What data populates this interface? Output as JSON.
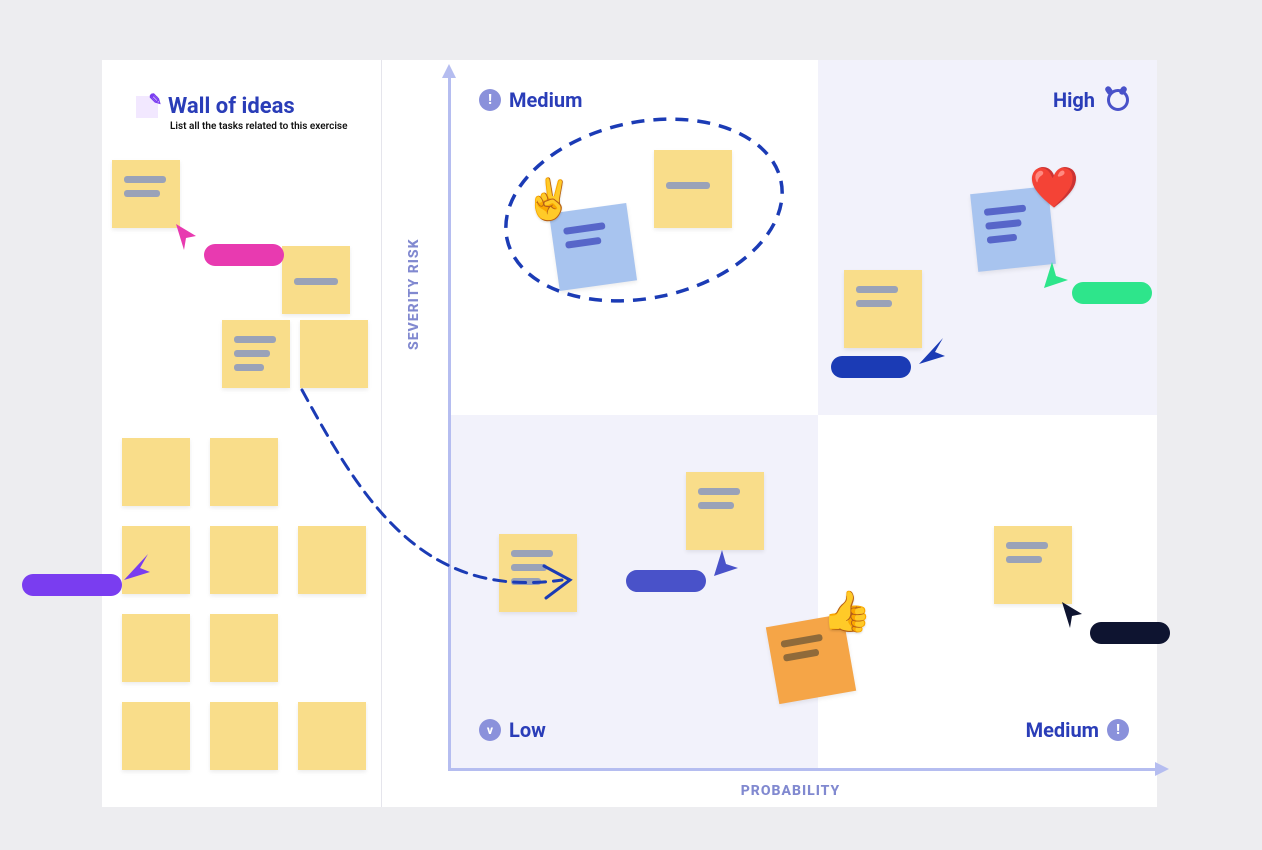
{
  "sidebar": {
    "title": "Wall of ideas",
    "subtitle": "List all the tasks related to this exercise"
  },
  "axes": {
    "y": "SEVERITY RISK",
    "x": "PROBABILITY"
  },
  "quadrants": {
    "top_left": {
      "label": "Medium",
      "badge": "!"
    },
    "top_right": {
      "label": "High"
    },
    "bottom_left": {
      "label": "Low",
      "badge": "v"
    },
    "bottom_right": {
      "label": "Medium",
      "badge": "!"
    }
  },
  "cursors": {
    "purple": "#7a3df0",
    "magenta": "#e83ab0",
    "navy": "#1b3bb5",
    "indigo": "#4952c9",
    "green": "#2ee58b",
    "black": "#0e1430"
  },
  "reactions": {
    "peace": "✌️",
    "thumbs_up": "👍",
    "heart": "❤️"
  },
  "colors": {
    "brand": "#2a3db8",
    "sticky_yellow": "#f9dd8a",
    "sticky_blue": "#a8c4ef",
    "sticky_orange": "#f5a547",
    "quadrant_tint": "#f2f2fb",
    "axis": "#b5bdf0"
  }
}
